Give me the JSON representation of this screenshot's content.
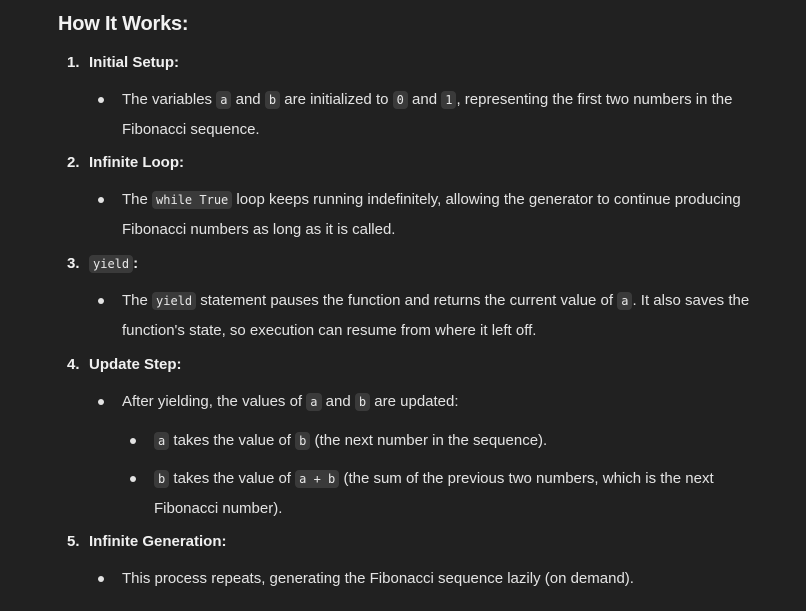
{
  "heading": "How It Works:",
  "steps": [
    {
      "number": "1.",
      "title": "Initial Setup",
      "title_suffix": ":",
      "bullets": [
        {
          "t1": "The variables ",
          "c1": "a",
          "t2": " and ",
          "c2": "b",
          "t3": " are initialized to ",
          "c3": "0",
          "t4": " and ",
          "c4": "1",
          "t5": ", representing the first two numbers in the Fibonacci sequence."
        }
      ]
    },
    {
      "number": "2.",
      "title": "Infinite Loop",
      "title_suffix": ":",
      "bullets": [
        {
          "t1": "The ",
          "c1": "while True",
          "t2": " loop keeps running indefinitely, allowing the generator to continue producing Fibonacci numbers as long as it is called."
        }
      ]
    },
    {
      "number": "3.",
      "title_code": "yield",
      "title_suffix": ":",
      "bullets": [
        {
          "t1": "The ",
          "c1": "yield",
          "t2": " statement pauses the function and returns the current value of ",
          "c2": "a",
          "t3": ". It also saves the function's state, so execution can resume from where it left off."
        }
      ]
    },
    {
      "number": "4.",
      "title": "Update Step",
      "title_suffix": ":",
      "bullets": [
        {
          "t1": "After yielding, the values of ",
          "c1": "a",
          "t2": " and ",
          "c2": "b",
          "t3": " are updated:"
        }
      ],
      "sub_bullets": [
        {
          "c1": "a",
          "t1": " takes the value of ",
          "c2": "b",
          "t2": " (the next number in the sequence)."
        },
        {
          "c1": "b",
          "t1": " takes the value of ",
          "c2": "a + b",
          "t2": " (the sum of the previous two numbers, which is the next Fibonacci number)."
        }
      ]
    },
    {
      "number": "5.",
      "title": "Infinite Generation",
      "title_suffix": ":",
      "bullets": [
        {
          "t1": "This process repeats, generating the Fibonacci sequence lazily (on demand)."
        }
      ]
    }
  ]
}
